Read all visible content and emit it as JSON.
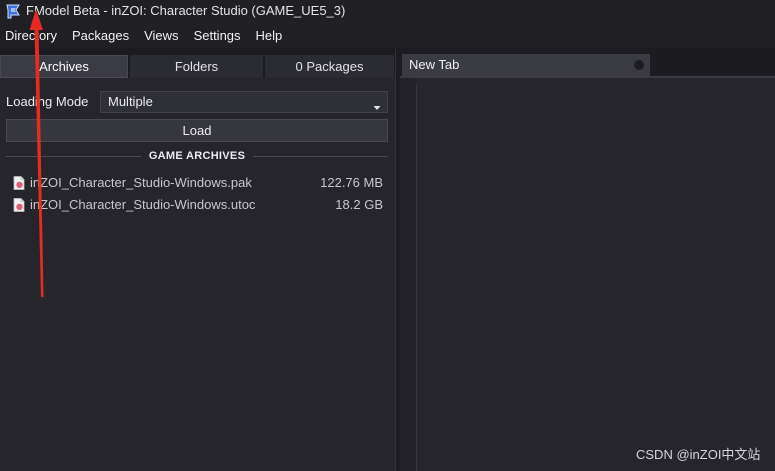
{
  "window": {
    "title": "FModel Beta - inZOI: Character Studio (GAME_UE5_3)",
    "icon": "fmodel-app-icon"
  },
  "menu": [
    {
      "label": "Directory"
    },
    {
      "label": "Packages"
    },
    {
      "label": "Views"
    },
    {
      "label": "Settings"
    },
    {
      "label": "Help"
    }
  ],
  "left_panel": {
    "tabs": [
      {
        "label": "Archives",
        "selected": true
      },
      {
        "label": "Folders",
        "selected": false
      },
      {
        "label": "0 Packages",
        "selected": false
      }
    ],
    "loading_mode": {
      "label": "Loading Mode",
      "value": "Multiple",
      "icon": "chevron-down-icon"
    },
    "load_button": "Load",
    "section_title": "GAME ARCHIVES",
    "archives": [
      {
        "name": "inZOI_Character_Studio-Windows.pak",
        "size": "122.76 MB",
        "icon": "archive-file-icon"
      },
      {
        "name": "inZOI_Character_Studio-Windows.utoc",
        "size": "18.2 GB",
        "icon": "archive-file-icon"
      }
    ]
  },
  "right_panel": {
    "tabs": [
      {
        "label": "New Tab",
        "icon": "close-circle-icon"
      }
    ]
  },
  "watermark": "CSDN @inZOI中文站",
  "colors": {
    "window_background": "#1f1f24",
    "panel_background": "#25252b",
    "selected_tab": "#3b3b45",
    "annotation_arrow": "#e52b23"
  }
}
